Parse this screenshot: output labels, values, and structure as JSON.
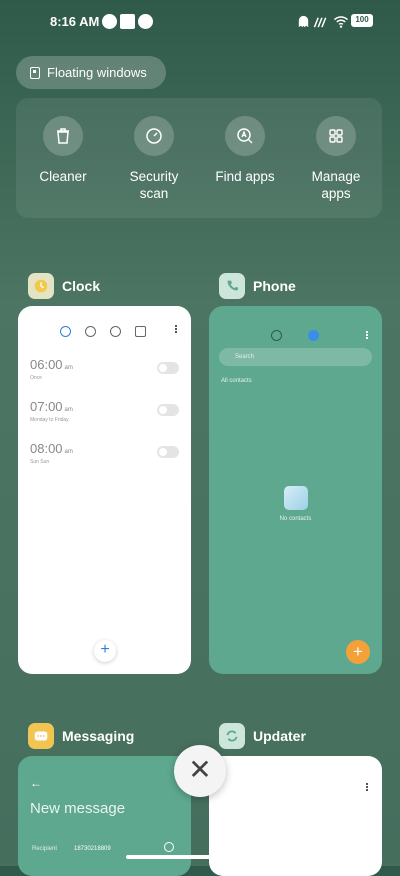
{
  "status_bar": {
    "time": "8:16 AM",
    "battery": "100"
  },
  "floating_windows": {
    "label": "Floating windows"
  },
  "quick_actions": [
    {
      "label": "Cleaner",
      "icon": "trash-icon"
    },
    {
      "label": "Security scan",
      "icon": "security-gauge-icon"
    },
    {
      "label": "Find apps",
      "icon": "search-apps-icon"
    },
    {
      "label": "Manage apps",
      "icon": "grid-icon"
    }
  ],
  "apps": {
    "clock": {
      "name": "Clock",
      "alarms": [
        {
          "time": "06:00",
          "ampm": "am",
          "label": "Once"
        },
        {
          "time": "07:00",
          "ampm": "am",
          "label": "Monday to Friday"
        },
        {
          "time": "08:00",
          "ampm": "am",
          "label": "Sun Sun"
        }
      ],
      "add_label": "+"
    },
    "phone": {
      "name": "Phone",
      "search_placeholder": "Search",
      "all_contacts": "All contacts",
      "empty_text": "No contacts",
      "add_label": "+"
    },
    "messaging": {
      "name": "Messaging",
      "back": "←",
      "title": "New message",
      "recipient_label": "Recipient",
      "recipient_number": "18730218809"
    },
    "updater": {
      "name": "Updater"
    }
  },
  "close_label": "✕",
  "colors": {
    "accent_blue": "#2a7de1",
    "phone_green": "#5ea88f",
    "fab_orange": "#f5a13a"
  }
}
